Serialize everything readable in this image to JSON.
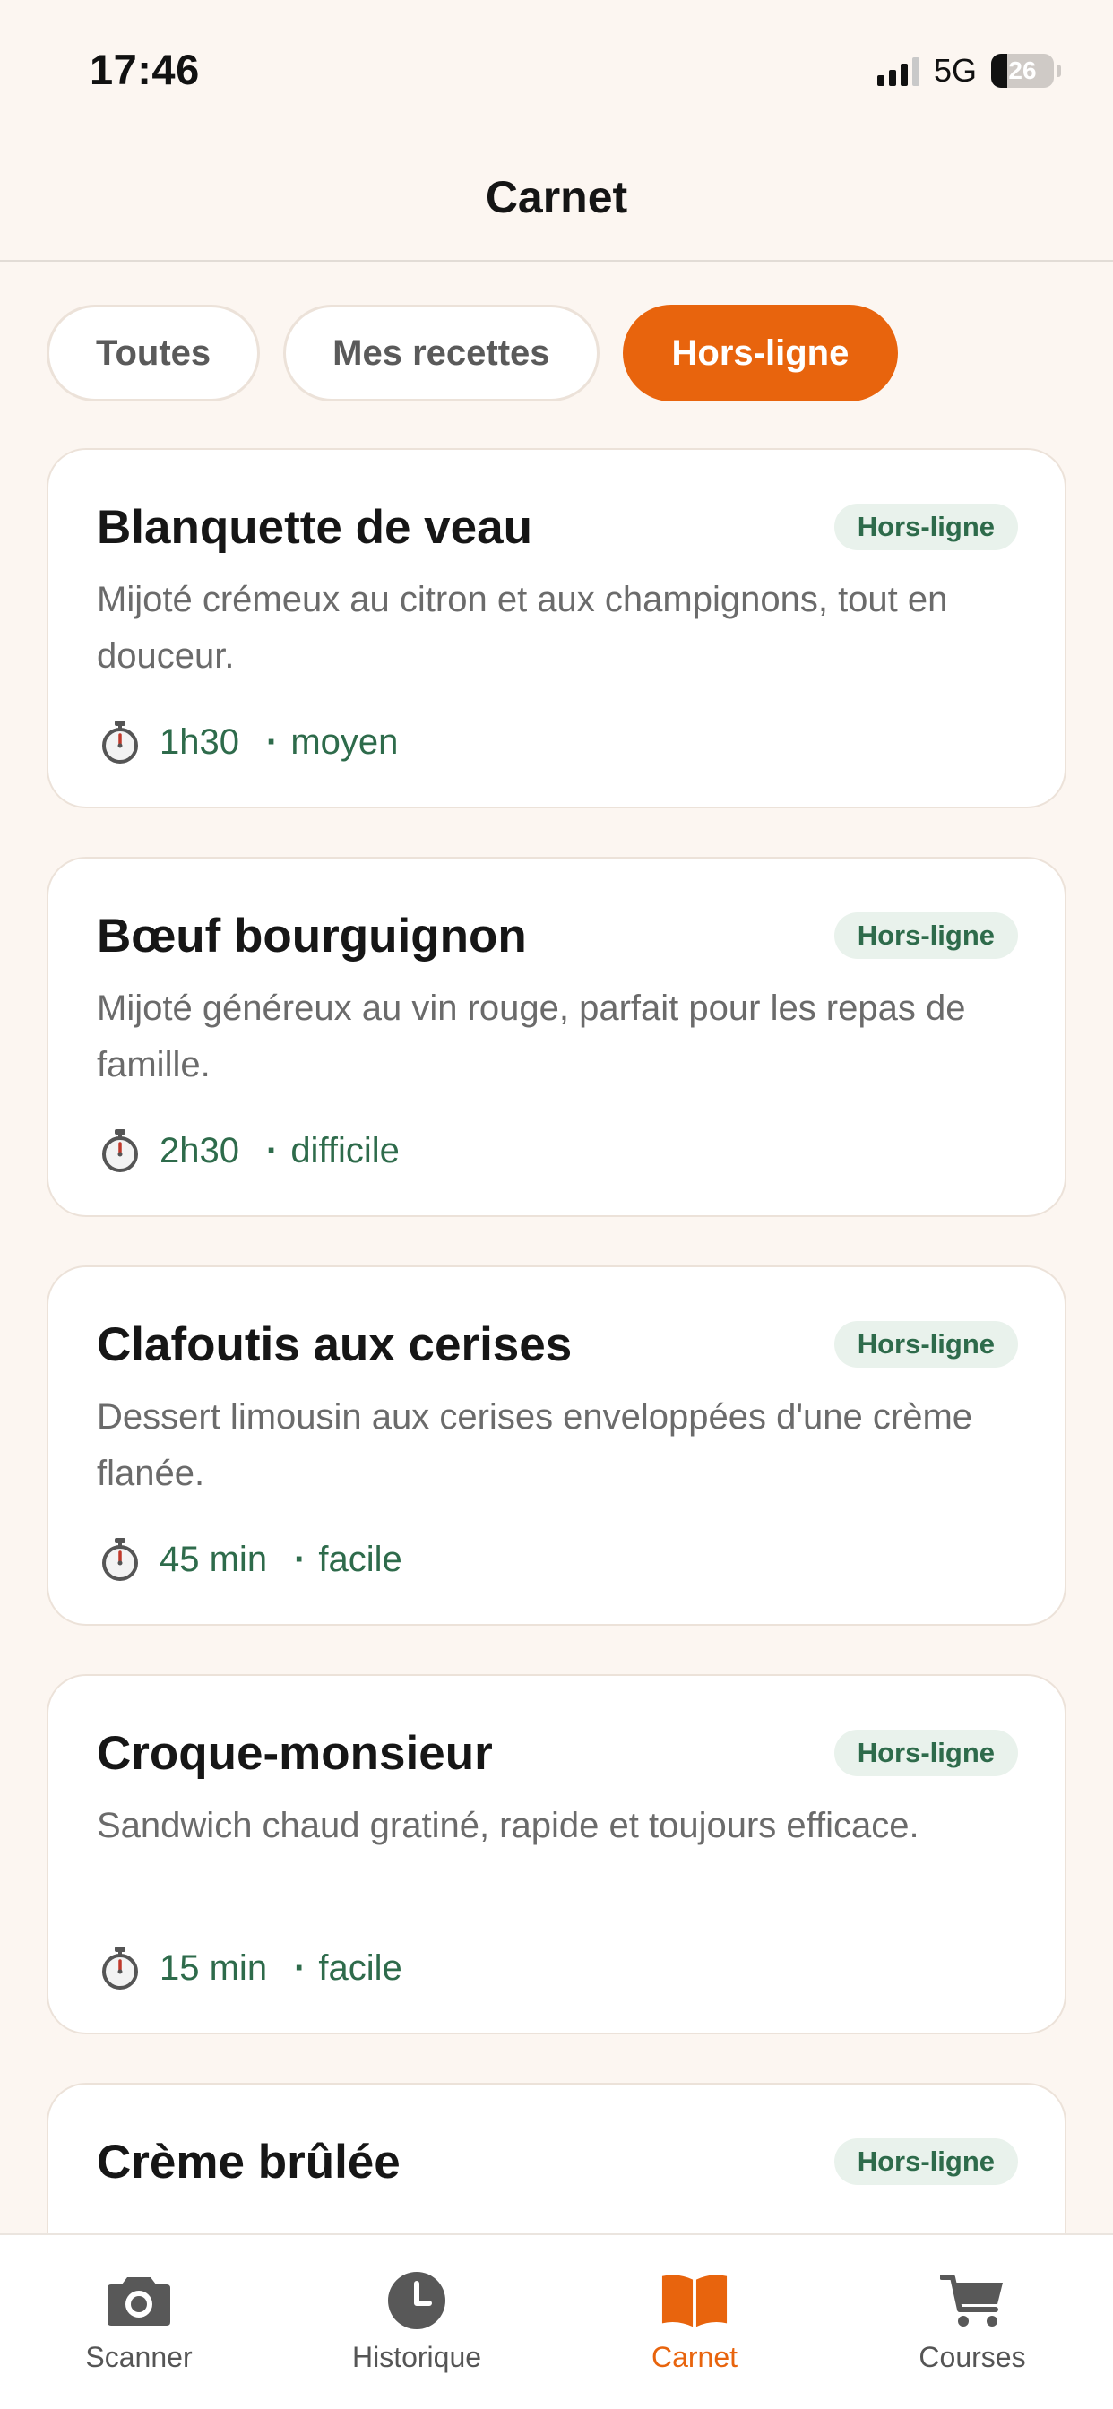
{
  "status_bar": {
    "time": "17:46",
    "network": "5G",
    "battery": "26",
    "battery_level": 0.26
  },
  "header": {
    "title": "Carnet"
  },
  "filters": [
    {
      "label": "Toutes",
      "active": false
    },
    {
      "label": "Mes recettes",
      "active": false
    },
    {
      "label": "Hors-ligne",
      "active": true
    }
  ],
  "recipes": [
    {
      "title": "Blanquette de veau",
      "badge": "Hors-ligne",
      "description": "Mijoté crémeux au citron et aux champignons, tout en douceur.",
      "time": "1h30",
      "level": "moyen"
    },
    {
      "title": "Bœuf bourguignon",
      "badge": "Hors-ligne",
      "description": "Mijoté généreux au vin rouge, parfait pour les repas de famille.",
      "time": "2h30",
      "level": "difficile"
    },
    {
      "title": "Clafoutis aux cerises",
      "badge": "Hors-ligne",
      "description": "Dessert limousin aux cerises enveloppées d'une crème flanée.",
      "time": "45 min",
      "level": "facile"
    },
    {
      "title": "Croque-monsieur",
      "badge": "Hors-ligne",
      "description": "Sandwich chaud gratiné, rapide et toujours efficace.",
      "time": "15 min",
      "level": "facile"
    },
    {
      "title": "Crème brûlée",
      "badge": "Hors-ligne"
    }
  ],
  "nav": [
    {
      "label": "Scanner",
      "icon": "camera-icon",
      "active": false
    },
    {
      "label": "Historique",
      "icon": "clock-icon",
      "active": false
    },
    {
      "label": "Carnet",
      "icon": "book-icon",
      "active": true
    },
    {
      "label": "Courses",
      "icon": "cart-icon",
      "active": false
    }
  ],
  "colors": {
    "accent": "#e8640d",
    "badge_bg": "#e9f2ec",
    "badge_text": "#2e6b4b",
    "background": "#fcf6f1"
  }
}
